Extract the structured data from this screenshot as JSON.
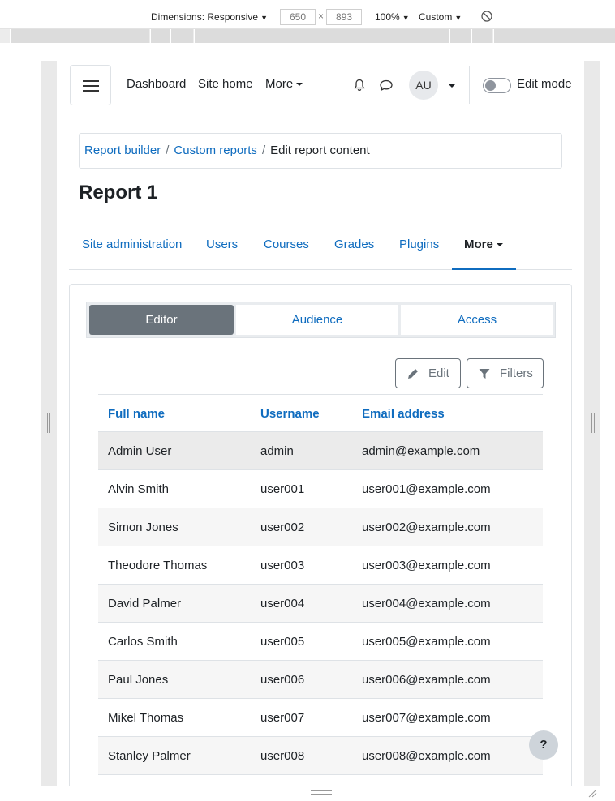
{
  "devtools": {
    "dimensions_label": "Dimensions: Responsive",
    "width": "650",
    "times": "×",
    "height": "893",
    "zoom": "100%",
    "throttle": "Custom"
  },
  "navbar": {
    "links": [
      "Dashboard",
      "Site home",
      "More"
    ],
    "avatar_initials": "AU",
    "edit_mode_label": "Edit mode"
  },
  "breadcrumb": {
    "items": [
      "Report builder",
      "Custom reports",
      "Edit report content"
    ],
    "separator": "/"
  },
  "page": {
    "title": "Report 1"
  },
  "secondary_nav": {
    "items": [
      "Site administration",
      "Users",
      "Courses",
      "Grades",
      "Plugins"
    ],
    "more_label": "More"
  },
  "tabs": {
    "editor": "Editor",
    "audience": "Audience",
    "access": "Access"
  },
  "toolbar": {
    "edit_label": "Edit",
    "filters_label": "Filters"
  },
  "table": {
    "headers": [
      "Full name",
      "Username",
      "Email address"
    ],
    "rows": [
      [
        "Admin User",
        "admin",
        "admin@example.com"
      ],
      [
        "Alvin Smith",
        "user001",
        "user001@example.com"
      ],
      [
        "Simon Jones",
        "user002",
        "user002@example.com"
      ],
      [
        "Theodore Thomas",
        "user003",
        "user003@example.com"
      ],
      [
        "David Palmer",
        "user004",
        "user004@example.com"
      ],
      [
        "Carlos Smith",
        "user005",
        "user005@example.com"
      ],
      [
        "Paul Jones",
        "user006",
        "user006@example.com"
      ],
      [
        "Mikel Thomas",
        "user007",
        "user007@example.com"
      ],
      [
        "Stanley Palmer",
        "user008",
        "user008@example.com"
      ]
    ]
  },
  "help": {
    "label": "?"
  },
  "colors": {
    "link": "#0f6cbf",
    "active_tab": "#6a737b"
  }
}
